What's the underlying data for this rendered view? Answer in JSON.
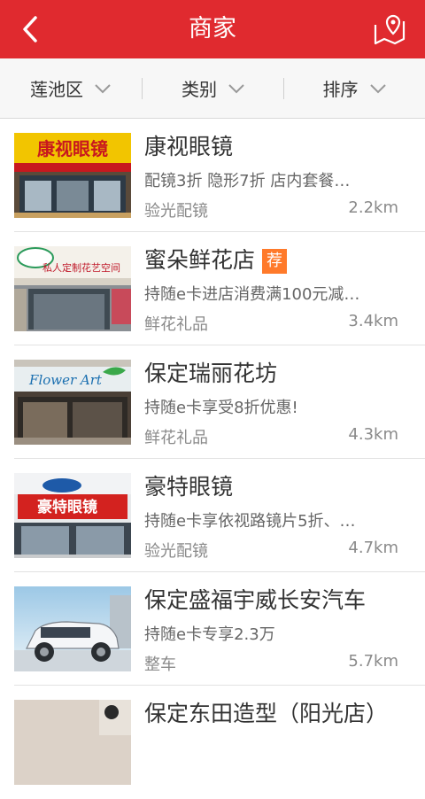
{
  "header": {
    "title": "商家",
    "back_icon": "chevron-left-icon",
    "map_icon": "map-pin-icon",
    "color": "#e02a2f"
  },
  "filters": [
    {
      "label": "莲池区"
    },
    {
      "label": "类别"
    },
    {
      "label": "排序"
    }
  ],
  "merchants": [
    {
      "name": "康视眼镜",
      "desc": "配镜3折 隐形7折  店内套餐…",
      "category": "验光配镜",
      "distance": "2.2km",
      "sign": "康视眼镜",
      "tag": ""
    },
    {
      "name": "蜜朵鲜花店",
      "desc": "持随e卡进店消费满100元减…",
      "category": "鲜花礼品",
      "distance": "3.4km",
      "sign": "私人定制花艺空间",
      "tag": "荐"
    },
    {
      "name": "保定瑞丽花坊",
      "desc": " 持随e卡享受8折优惠!",
      "category": "鲜花礼品",
      "distance": "4.3km",
      "sign": "Flower Art",
      "tag": ""
    },
    {
      "name": "豪特眼镜",
      "desc": "持随e卡享依视路镜片5折、…",
      "category": "验光配镜",
      "distance": "4.7km",
      "sign": "豪特眼镜",
      "tag": ""
    },
    {
      "name": "保定盛福宇威长安汽车",
      "desc": "持随e卡专享2.3万",
      "category": "整车",
      "distance": "5.7km",
      "sign": "",
      "tag": ""
    },
    {
      "name": "保定东田造型（阳光店）",
      "desc": "",
      "category": "",
      "distance": "",
      "sign": "",
      "tag": ""
    }
  ]
}
